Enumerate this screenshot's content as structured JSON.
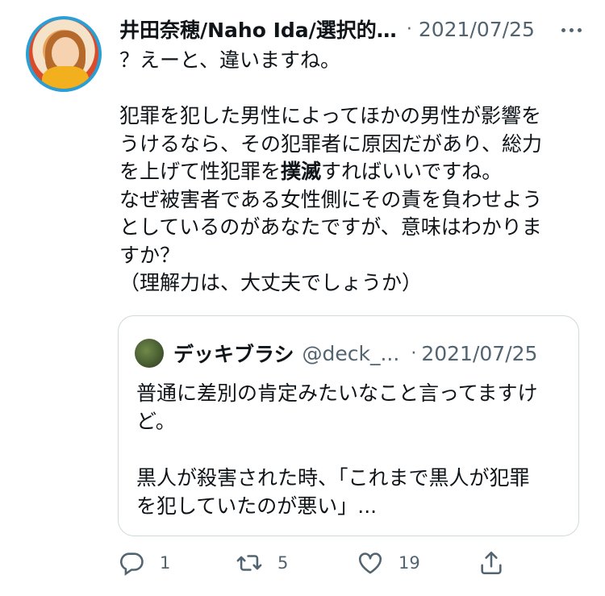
{
  "tweet": {
    "author_name": "井田奈穂/Naho Ida/選択的…",
    "separator": "·",
    "date": "2021/07/25",
    "text_line_1": "？えーと、違いますね。",
    "text_blank": "",
    "text_line_2": "犯罪を犯した男性によってほかの男性が影響を",
    "text_line_3": "うけるなら、その犯罪者に原因だがあり、総力",
    "text_line_4a": "を上げて性犯罪を",
    "text_line_4b": "撲滅",
    "text_line_4c": "すればいいですね。",
    "text_line_5": "なぜ被害者である女性側にその責を負わせよう",
    "text_line_6": "としているのがあなたですが、意味はわかりま",
    "text_line_7": "すか？",
    "text_line_8": "（理解力は、大丈夫でしょうか）"
  },
  "quoted": {
    "author_name": "デッキブラシ",
    "handle": "@deck_...",
    "separator": "·",
    "date": "2021/07/25",
    "text_line_1": "普通に差別の肯定みたいなこと言ってますけ",
    "text_line_2": "ど。",
    "text_blank": "",
    "text_line_3": "黒人が殺害された時、「これまで黒人が犯罪",
    "text_line_4": "を犯していたのが悪い」..."
  },
  "actions": {
    "reply_count": "1",
    "retweet_count": "5",
    "like_count": "19"
  },
  "icons": {
    "more": "more-horizontal-icon",
    "reply": "reply-icon",
    "retweet": "retweet-icon",
    "like": "heart-icon",
    "share": "share-icon"
  },
  "colors": {
    "text": "#0f1419",
    "secondary": "#536471",
    "border": "#cfd9de"
  }
}
